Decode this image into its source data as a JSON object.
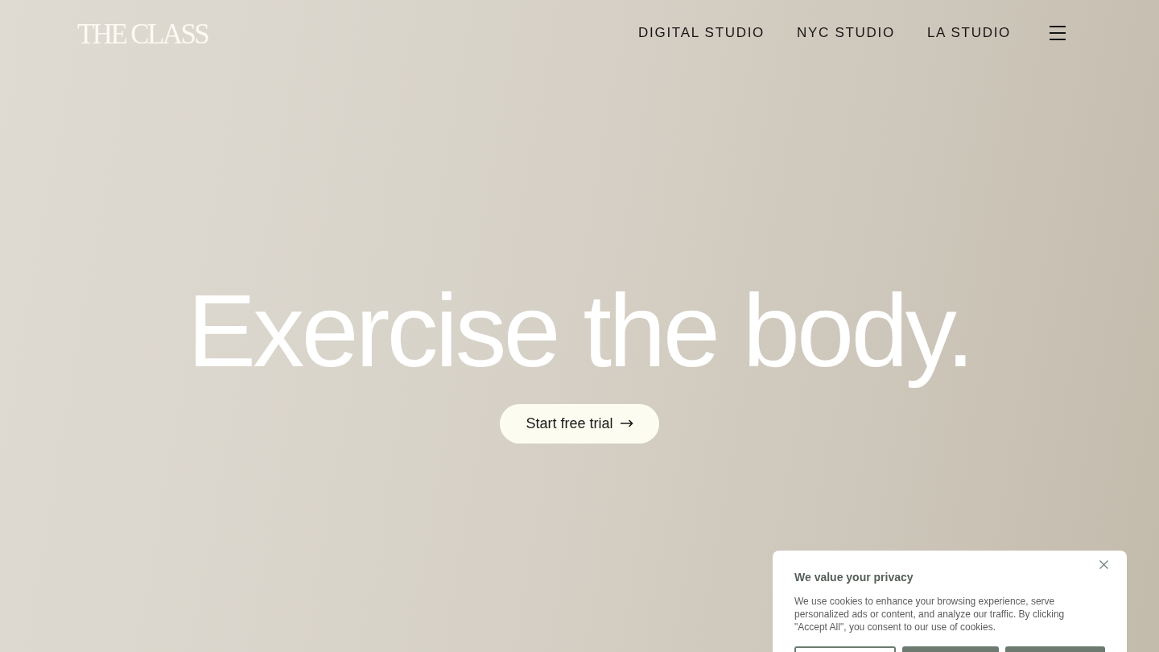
{
  "header": {
    "logo": "THE CLASS",
    "nav": [
      {
        "label": "DIGITAL STUDIO"
      },
      {
        "label": "NYC STUDIO"
      },
      {
        "label": "LA STUDIO"
      }
    ]
  },
  "hero": {
    "headline": "Exercise the body.",
    "cta": "Start free trial"
  },
  "cookie_banner": {
    "title": "We value your privacy",
    "body": "We use cookies to enhance your browsing experience, serve personalized ads or content, and analyze our traffic. By clicking \"Accept All\", you consent to our use of cookies.",
    "buttons": [
      {
        "kind": "outline"
      },
      {
        "kind": "filled"
      },
      {
        "kind": "filled"
      }
    ]
  }
}
